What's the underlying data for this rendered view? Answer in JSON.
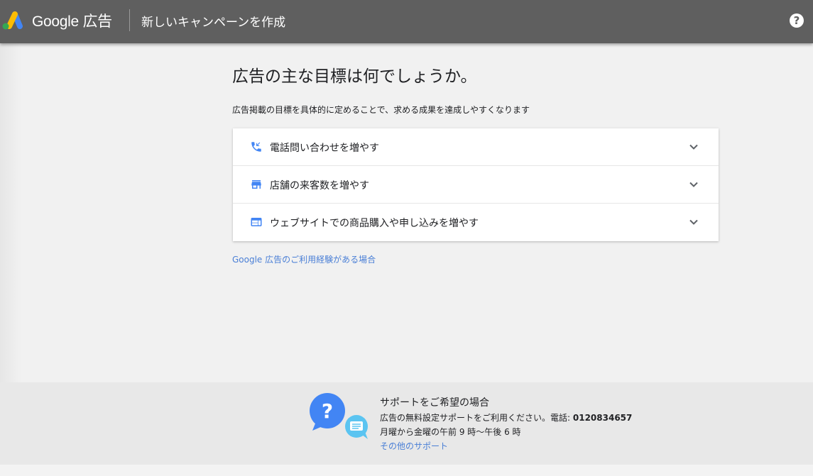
{
  "header": {
    "brand": "Google 広告",
    "page_title": "新しいキャンペーンを作成",
    "help_symbol": "?"
  },
  "main": {
    "title": "広告の主な目標は何でしょうか。",
    "subtitle": "広告掲載の目標を具体的に定めることで、求める成果を達成しやすくなります",
    "goals": [
      {
        "label": "電話問い合わせを増やす",
        "icon": "phone-call-icon"
      },
      {
        "label": "店舗の来客数を増やす",
        "icon": "storefront-icon"
      },
      {
        "label": "ウェブサイトでの商品購入や申し込みを増やす",
        "icon": "web-page-icon"
      }
    ],
    "experienced_link": "Google 広告のご利用経験がある場合"
  },
  "support": {
    "title": "サポートをご希望の場合",
    "line1_prefix": "広告の無料設定サポートをご利用ください。電話: ",
    "phone": "0120834657",
    "hours": "月曜から金曜の午前 9 時〜午後 6 時",
    "other_link": "その他のサポート"
  },
  "colors": {
    "header_bg": "#5f5f5f",
    "accent_blue": "#4285f4",
    "link_blue": "#4a7fd6",
    "logo_yellow": "#fbbc04",
    "logo_green": "#34a853",
    "chat_bubble": "#5bc4f1"
  }
}
